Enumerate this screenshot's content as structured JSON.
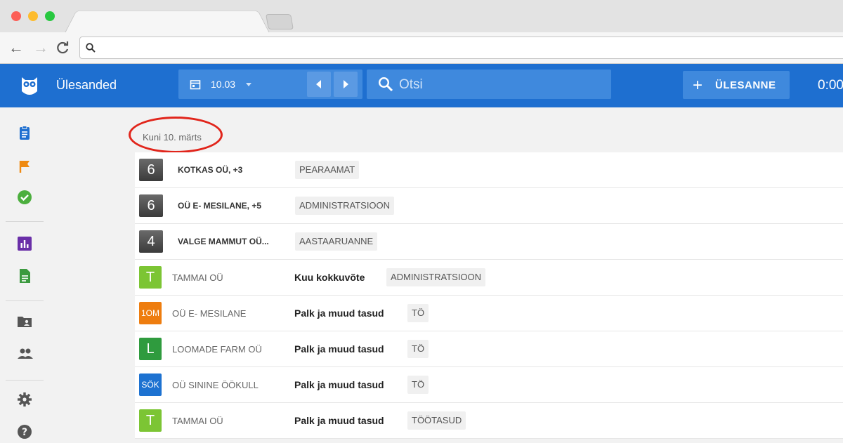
{
  "browser": {
    "url": ""
  },
  "app": {
    "title": "Ülesanded"
  },
  "header": {
    "date_label": "10.03",
    "search_placeholder": "Otsi",
    "add_button_label": "ÜLESANNE",
    "timer": "0:00"
  },
  "group": {
    "label": "Kuni 10. märts"
  },
  "colors": {
    "appbar": "#1e6fd0",
    "badge_green": "#7cc534",
    "badge_orange": "#ee7d0f",
    "badge_darkgreen": "#2f9b3e",
    "badge_blue": "#1d72d1",
    "highlight_circle": "#e1251b"
  },
  "rows": [
    {
      "badge": "6",
      "badge_style": "dark",
      "client": "KOTKAS OÜ, +3",
      "task": "",
      "tag": "PEARAAMAT"
    },
    {
      "badge": "6",
      "badge_style": "dark",
      "client": "OÜ E- MESILANE, +5",
      "task": "",
      "tag": "ADMINISTRATSIOON"
    },
    {
      "badge": "4",
      "badge_style": "dark",
      "client": "VALGE MAMMUT OÜ...",
      "task": "",
      "tag": "AASTAARUANNE"
    },
    {
      "badge": "T",
      "badge_style": "green",
      "client": "TAMMAI OÜ",
      "task": "Kuu kokkuvõte",
      "tag": "ADMINISTRATSIOON"
    },
    {
      "badge": "1OM",
      "badge_style": "orange",
      "client": "OÜ E- MESILANE",
      "task": "Palk ja muud tasud",
      "tag": "TÖ"
    },
    {
      "badge": "L",
      "badge_style": "darkgreen",
      "client": "LOOMADE FARM OÜ",
      "task": "Palk ja muud tasud",
      "tag": "TÖ"
    },
    {
      "badge": "SÖK",
      "badge_style": "blue",
      "client": "OÜ SININE ÖÖKULL",
      "task": "Palk ja muud tasud",
      "tag": "TÖ"
    },
    {
      "badge": "T",
      "badge_style": "green",
      "client": "TAMMAI OÜ",
      "task": "Palk ja muud tasud",
      "tag": "TÖÖTASUD"
    }
  ]
}
